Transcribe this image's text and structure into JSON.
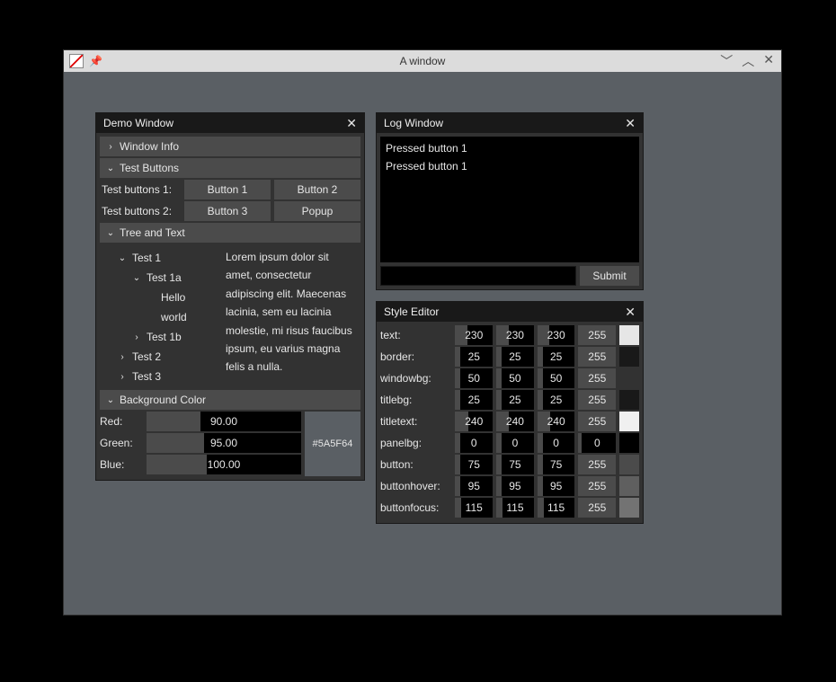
{
  "outer": {
    "title": "A window"
  },
  "demo": {
    "title": "Demo Window",
    "sections": {
      "window_info": "Window Info",
      "test_buttons": "Test Buttons",
      "tree_and_text": "Tree and Text",
      "background_color": "Background Color"
    },
    "test_rows": {
      "row1_label": "Test buttons 1:",
      "row1_btn1": "Button 1",
      "row1_btn2": "Button 2",
      "row2_label": "Test buttons 2:",
      "row2_btn1": "Button 3",
      "row2_btn2": "Popup"
    },
    "tree": {
      "test1": "Test 1",
      "test1a": "Test 1a",
      "hello": "Hello",
      "world": "world",
      "test1b": "Test 1b",
      "test2": "Test 2",
      "test3": "Test 3"
    },
    "lorem": "Lorem ipsum dolor sit amet, consectetur adipiscing elit. Maecenas lacinia, sem eu lacinia molestie, mi risus faucibus ipsum, eu varius magna felis a nulla.",
    "bg": {
      "red_label": "Red:",
      "red_val": "90.00",
      "red_pct": 35,
      "green_label": "Green:",
      "green_val": "95.00",
      "green_pct": 37,
      "blue_label": "Blue:",
      "blue_val": "100.00",
      "blue_pct": 39,
      "hex": "#5A5F64"
    }
  },
  "log": {
    "title": "Log Window",
    "lines": [
      "Pressed button 1",
      "Pressed button 1"
    ],
    "submit": "Submit"
  },
  "style": {
    "title": "Style Editor",
    "rows": [
      {
        "name": "text:",
        "r": 230,
        "g": 230,
        "b": 230,
        "a": 255,
        "swatch": "#e6e6e6"
      },
      {
        "name": "border:",
        "r": 25,
        "g": 25,
        "b": 25,
        "a": 255,
        "swatch": "#191919"
      },
      {
        "name": "windowbg:",
        "r": 50,
        "g": 50,
        "b": 50,
        "a": 255,
        "swatch": "#323232"
      },
      {
        "name": "titlebg:",
        "r": 25,
        "g": 25,
        "b": 25,
        "a": 255,
        "swatch": "#191919"
      },
      {
        "name": "titletext:",
        "r": 240,
        "g": 240,
        "b": 240,
        "a": 255,
        "swatch": "#f0f0f0"
      },
      {
        "name": "panelbg:",
        "r": 0,
        "g": 0,
        "b": 0,
        "a": 0,
        "swatch": "#000000"
      },
      {
        "name": "button:",
        "r": 75,
        "g": 75,
        "b": 75,
        "a": 255,
        "swatch": "#4b4b4b"
      },
      {
        "name": "buttonhover:",
        "r": 95,
        "g": 95,
        "b": 95,
        "a": 255,
        "swatch": "#5f5f5f"
      },
      {
        "name": "buttonfocus:",
        "r": 115,
        "g": 115,
        "b": 115,
        "a": 255,
        "swatch": "#737373"
      }
    ]
  }
}
